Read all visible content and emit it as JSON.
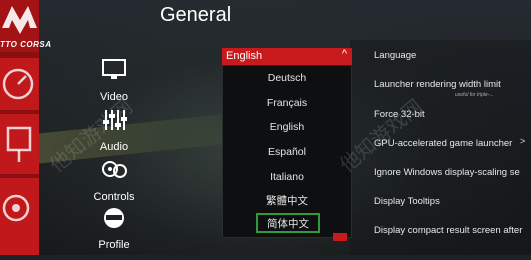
{
  "logo": {
    "text": "TTO CORSA"
  },
  "page_title": "General",
  "categories": [
    {
      "label": "Video",
      "icon": "monitor-icon"
    },
    {
      "label": "Audio",
      "icon": "mixer-sliders-icon"
    },
    {
      "label": "Controls",
      "icon": "gamepad-wheel-icon"
    },
    {
      "label": "Profile",
      "icon": "driver-helmet-icon"
    }
  ],
  "language_dropdown": {
    "selected": "English",
    "chevron": "^",
    "options": [
      "Deutsch",
      "Français",
      "English",
      "Español",
      "Italiano",
      "繁體中文",
      "简体中文"
    ],
    "highlighted": "简体中文"
  },
  "settings": [
    {
      "label": "Language"
    },
    {
      "label": "Launcher rendering width limit",
      "sublabel": "useful for triple-..."
    },
    {
      "label": "Force 32-bit"
    },
    {
      "label": "GPU-accelerated game launcher"
    },
    {
      "label": "Ignore Windows display-scaling se"
    },
    {
      "label": "Display Tooltips"
    },
    {
      "label": "Display compact result screen after"
    }
  ],
  "watermark": "他知游戏网",
  "colors": {
    "accent_red": "#c81a1c",
    "highlight_green": "#2f9a3c",
    "strip_red": "#8b0e10"
  }
}
